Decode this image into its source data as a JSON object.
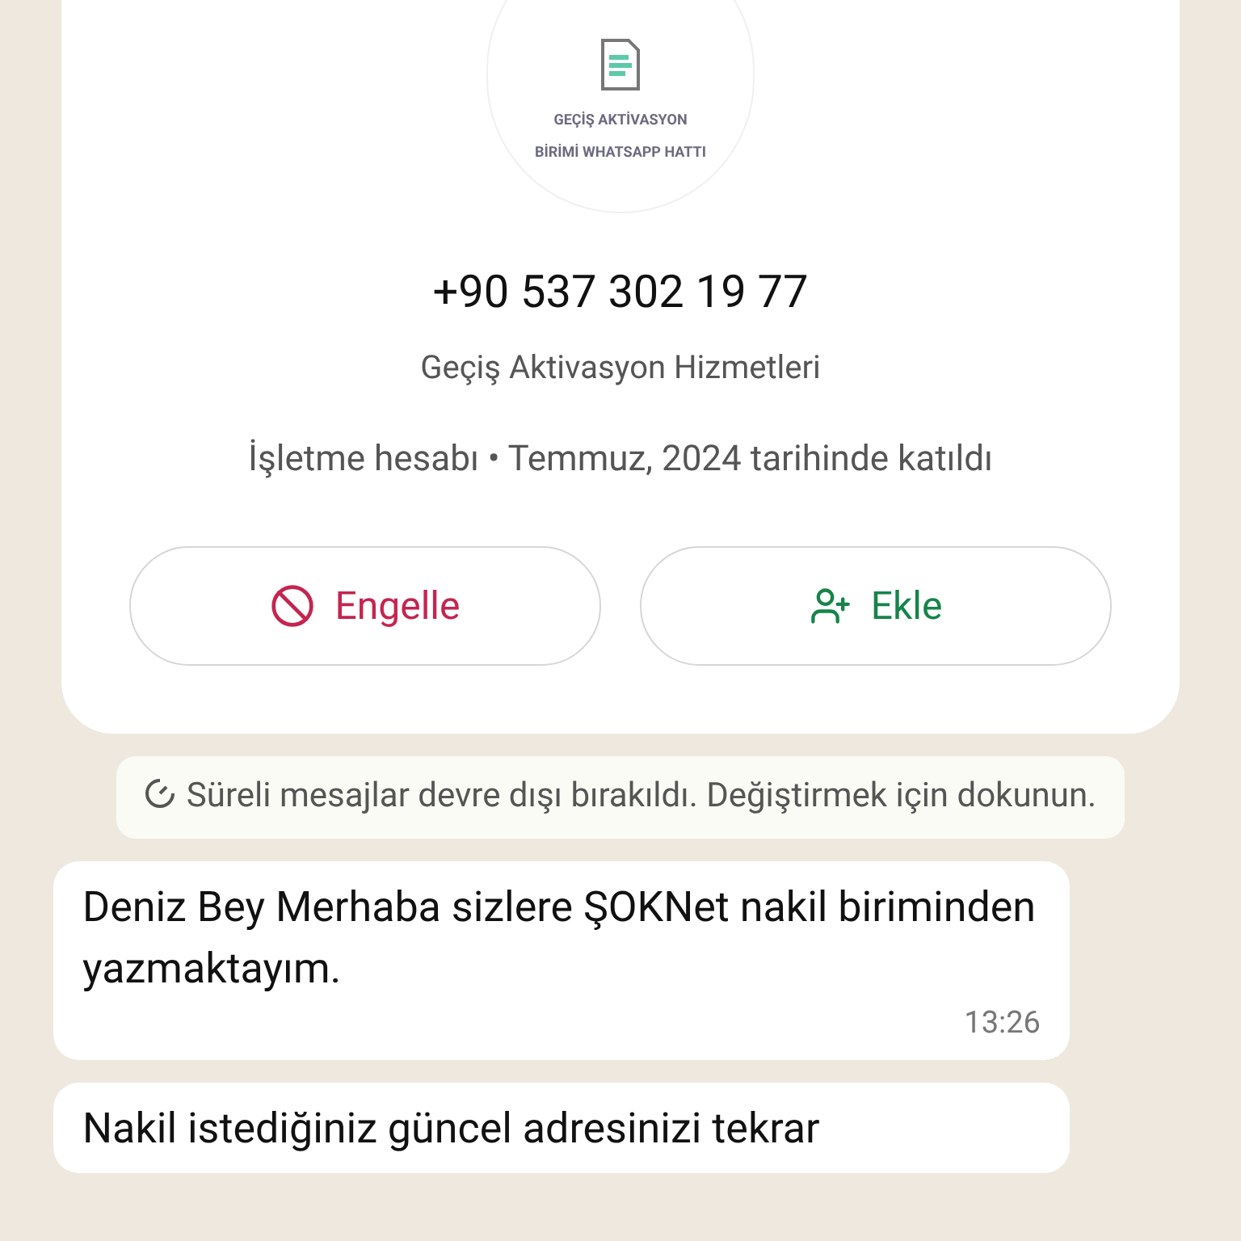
{
  "profile": {
    "avatar_text": "GEÇİŞ AKTİVASYON BİRİMİ WHATSAPP HATTI",
    "phone": "+90 537 302 19 77",
    "name": "Geçiş Aktivasyon Hizmetleri",
    "info": "İşletme hesabı • Temmuz, 2024 tarihinde katıldı"
  },
  "actions": [
    {
      "kind": "block",
      "label": "Engelle"
    },
    {
      "kind": "add",
      "label": "Ekle"
    }
  ],
  "system_message": "Süreli mesajlar devre dışı bırakıldı. Değiştirmek için dokunun.",
  "messages": [
    {
      "text": "Deniz Bey Merhaba sizlere ŞOKNet nakil biriminden yazmaktayım.",
      "time": "13:26"
    },
    {
      "text": "Nakil istediğiniz güncel adresinizi tekrar"
    }
  ]
}
